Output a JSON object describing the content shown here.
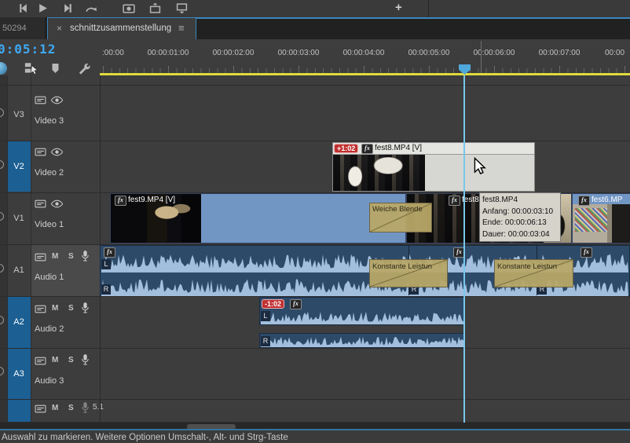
{
  "toolbar": {
    "icons": [
      "step-back",
      "play",
      "step-forward",
      "play-around",
      "export-frame",
      "lift",
      "extract"
    ],
    "plus_glyph": "+"
  },
  "tabs": {
    "inactive_label": "50294",
    "active_label": "schnittzusammenstellung",
    "close_glyph": "×",
    "menu_glyph": "≡"
  },
  "playhead": {
    "timecode": "0:05:12"
  },
  "ruler": {
    "labels": [
      ":00:00",
      "00:00:01:00",
      "00:00:02:00",
      "00:00:03:00",
      "00:00:04:00",
      "00:00:05:00",
      "00:00:06:00",
      "00:00:07:00",
      "00:00"
    ]
  },
  "tool_icons": [
    "snap",
    "linked-selection",
    "add-marker",
    "timeline-settings"
  ],
  "buttons": {
    "mute": "M",
    "solo": "S"
  },
  "tracks": {
    "video": [
      {
        "id": "V3",
        "name": "Video 3",
        "targeted": false
      },
      {
        "id": "V2",
        "name": "Video 2",
        "targeted": true
      },
      {
        "id": "V1",
        "name": "Video 1",
        "targeted": false
      }
    ],
    "audio": [
      {
        "id": "A1",
        "name": "Audio 1",
        "targeted": false
      },
      {
        "id": "A2",
        "name": "Audio 2",
        "targeted": true
      },
      {
        "id": "A3",
        "name": "Audio 3",
        "targeted": true
      }
    ],
    "master": {
      "label": "5.1"
    }
  },
  "badges": {
    "fx": "fx",
    "v2_sync": "+1:02",
    "a2_sync": "-1:02"
  },
  "channels": {
    "left": "L",
    "right": "R"
  },
  "clips": {
    "v2_fest8": {
      "label": "fest8.MP4 [V]",
      "selected": true
    },
    "v1_fest9": {
      "label": "fest9.MP4 [V]"
    },
    "v1_fest8": {
      "label": "fest8.MP4"
    },
    "v1_fest6": {
      "label": "fest6.MP"
    }
  },
  "transitions": {
    "video": "Weiche Blende",
    "audio": "Konstante Leistun"
  },
  "tooltip": {
    "title": "fest8.MP4",
    "start": "Anfang: 00:00:03:10",
    "end": "Ende: 00:00:06:13",
    "duration": "Dauer: 00:00:03:04"
  },
  "status_bar": "Auswahl zu markieren. Weitere Optionen Umschalt-, Alt- und Strg-Taste",
  "colors": {
    "accent_blue": "#3a87c0",
    "timecode_blue": "#3fa9f5",
    "target_track_blue": "#1b5f93",
    "video_clip": "#7296c4",
    "selected_clip": "#d6d6d3",
    "audio_clip": "#2e4a69",
    "waveform": "#a3bfdd",
    "transition_tan": "#b7a767",
    "sync_badge_red": "#c03030",
    "work_area_yellow": "#dedb3d",
    "playhead_blue": "#79c6ec"
  }
}
